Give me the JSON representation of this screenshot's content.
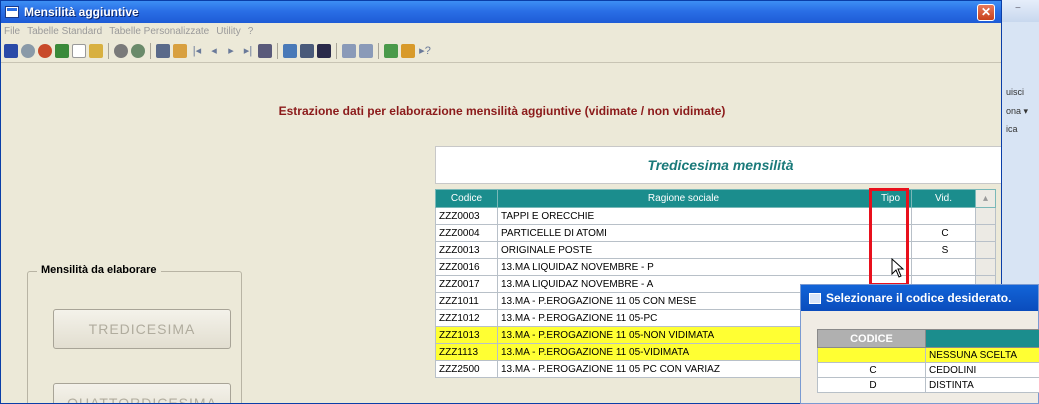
{
  "background_window": {
    "labels": [
      "uisci",
      "ona ▾",
      "ica"
    ],
    "minimize_glyph": "−"
  },
  "window": {
    "title": "Mensilità aggiuntive",
    "close_glyph": "✕"
  },
  "menu": [
    "File",
    "Tabelle Standard",
    "Tabelle Personalizzate",
    "Utility",
    "?"
  ],
  "heading": "Estrazione dati per elaborazione mensilità aggiuntive (vidimate / non vidimate)",
  "group": {
    "label": "Mensilità da elaborare",
    "buttons": [
      "TREDICESIMA",
      "QUATTORDICESIMA"
    ]
  },
  "tredicesima": {
    "title": "Tredicesima mensilità",
    "columns": [
      "Codice",
      "Ragione sociale",
      "Tipo",
      "Vid."
    ],
    "rows": [
      {
        "code": "ZZZ0003",
        "name": "TAPPI E ORECCHIE",
        "tipo": "",
        "vid": "",
        "highlight": false
      },
      {
        "code": "ZZZ0004",
        "name": "PARTICELLE DI ATOMI",
        "tipo": "",
        "vid": "C",
        "highlight": false
      },
      {
        "code": "ZZZ0013",
        "name": "ORIGINALE POSTE",
        "tipo": "",
        "vid": "S",
        "highlight": false
      },
      {
        "code": "ZZZ0016",
        "name": "13.MA LIQUIDAZ NOVEMBRE - P",
        "tipo": "",
        "vid": "",
        "highlight": false
      },
      {
        "code": "ZZZ0017",
        "name": "13.MA LIQUIDAZ NOVEMBRE - A",
        "tipo": "",
        "vid": "",
        "highlight": false
      },
      {
        "code": "ZZZ1011",
        "name": "13.MA - P.EROGAZIONE 11 05 CON MESE",
        "tipo": "",
        "vid": "",
        "highlight": false
      },
      {
        "code": "ZZZ1012",
        "name": "13.MA - P.EROGAZIONE 11 05-PC",
        "tipo": "",
        "vid": "",
        "highlight": false
      },
      {
        "code": "ZZZ1013",
        "name": "13.MA - P.EROGAZIONE 11 05-NON VIDIMATA",
        "tipo": "",
        "vid": "",
        "highlight": true
      },
      {
        "code": "ZZZ1113",
        "name": "13.MA - P.EROGAZIONE 11 05-VIDIMATA",
        "tipo": "",
        "vid": "",
        "highlight": true
      },
      {
        "code": "ZZZ2500",
        "name": "13.MA - P.EROGAZIONE 11 05 PC CON VARIAZ",
        "tipo": "",
        "vid": "",
        "highlight": false
      }
    ]
  },
  "popup": {
    "title": "Selezionare il codice desiderato.",
    "columns": [
      "CODICE",
      ""
    ],
    "rows": [
      {
        "code": "",
        "label": "NESSUNA SCELTA",
        "highlight": true
      },
      {
        "code": "C",
        "label": "CEDOLINI",
        "highlight": false
      },
      {
        "code": "D",
        "label": "DISTINTA",
        "highlight": false
      }
    ]
  },
  "colors": {
    "heading": "#8b1a1a",
    "grid_header": "#1b8d8d",
    "highlight": "#ffff33",
    "callout": "#e8101c"
  }
}
